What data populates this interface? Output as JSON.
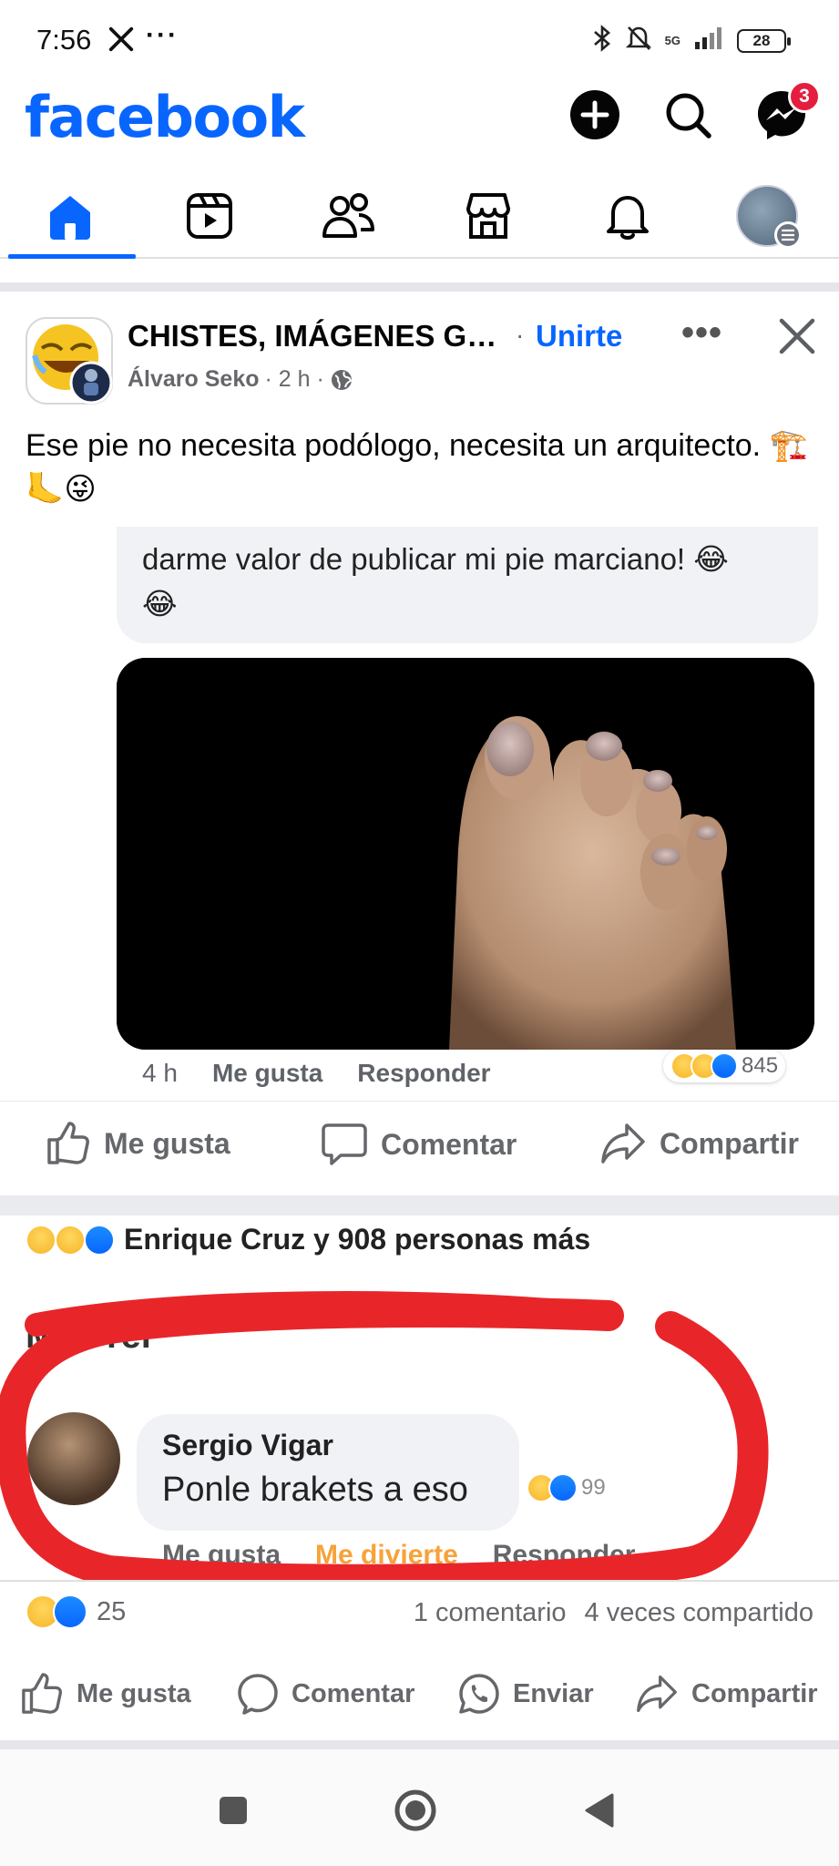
{
  "status_bar": {
    "time": "7:56",
    "dots": "···",
    "network": "5G",
    "battery": "28"
  },
  "header": {
    "logo": "facebook",
    "messenger_badge": "3"
  },
  "post": {
    "group_name": "CHISTES, IMÁGENES G…",
    "dot": "·",
    "join_label": "Unirte",
    "more_label": "•••",
    "author": "Álvaro Seko",
    "time": "· 2 h ·",
    "text": "Ese pie no necesita podólogo, necesita un arquitecto. 🏗️🦶😜",
    "reaction_count": "25",
    "comments": "1 comentario",
    "shares": "4 veces compartido"
  },
  "embed": {
    "top_text": "darme valor de publicar mi pie marciano! 😂",
    "top_text_cont": "😂",
    "comment_time": "4 h",
    "comment_like": "Me gusta",
    "comment_reply": "Responder",
    "comment_reactions": "845",
    "action_like": "Me gusta",
    "action_comment": "Comentar",
    "action_share": "Compartir",
    "reactors": "Enrique Cruz y 908 personas más",
    "section_heading": "Más rel",
    "commenter_name": "Sergio Vigar",
    "commenter_text": "Ponle brakets a eso",
    "commenter_reactions": "99",
    "commenter_action_1": "Me gusta",
    "commenter_action_2": "Me divierte",
    "commenter_action_3": "Responder"
  },
  "actions": {
    "like": "Me gusta",
    "comment": "Comentar",
    "send": "Enviar",
    "share": "Compartir"
  },
  "colors": {
    "brand": "#0866ff",
    "badge": "#e41e3f",
    "annotation": "#e8262a"
  }
}
